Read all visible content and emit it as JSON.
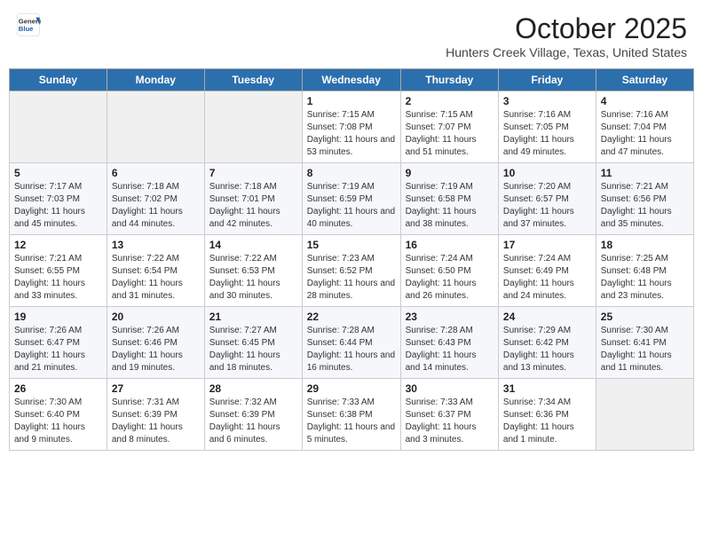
{
  "header": {
    "logo_general": "General",
    "logo_blue": "Blue",
    "month_title": "October 2025",
    "location": "Hunters Creek Village, Texas, United States"
  },
  "days_of_week": [
    "Sunday",
    "Monday",
    "Tuesday",
    "Wednesday",
    "Thursday",
    "Friday",
    "Saturday"
  ],
  "weeks": [
    [
      {
        "day": "",
        "empty": true
      },
      {
        "day": "",
        "empty": true
      },
      {
        "day": "",
        "empty": true
      },
      {
        "day": "1",
        "sunrise": "7:15 AM",
        "sunset": "7:08 PM",
        "daylight": "11 hours and 53 minutes."
      },
      {
        "day": "2",
        "sunrise": "7:15 AM",
        "sunset": "7:07 PM",
        "daylight": "11 hours and 51 minutes."
      },
      {
        "day": "3",
        "sunrise": "7:16 AM",
        "sunset": "7:05 PM",
        "daylight": "11 hours and 49 minutes."
      },
      {
        "day": "4",
        "sunrise": "7:16 AM",
        "sunset": "7:04 PM",
        "daylight": "11 hours and 47 minutes."
      }
    ],
    [
      {
        "day": "5",
        "sunrise": "7:17 AM",
        "sunset": "7:03 PM",
        "daylight": "11 hours and 45 minutes."
      },
      {
        "day": "6",
        "sunrise": "7:18 AM",
        "sunset": "7:02 PM",
        "daylight": "11 hours and 44 minutes."
      },
      {
        "day": "7",
        "sunrise": "7:18 AM",
        "sunset": "7:01 PM",
        "daylight": "11 hours and 42 minutes."
      },
      {
        "day": "8",
        "sunrise": "7:19 AM",
        "sunset": "6:59 PM",
        "daylight": "11 hours and 40 minutes."
      },
      {
        "day": "9",
        "sunrise": "7:19 AM",
        "sunset": "6:58 PM",
        "daylight": "11 hours and 38 minutes."
      },
      {
        "day": "10",
        "sunrise": "7:20 AM",
        "sunset": "6:57 PM",
        "daylight": "11 hours and 37 minutes."
      },
      {
        "day": "11",
        "sunrise": "7:21 AM",
        "sunset": "6:56 PM",
        "daylight": "11 hours and 35 minutes."
      }
    ],
    [
      {
        "day": "12",
        "sunrise": "7:21 AM",
        "sunset": "6:55 PM",
        "daylight": "11 hours and 33 minutes."
      },
      {
        "day": "13",
        "sunrise": "7:22 AM",
        "sunset": "6:54 PM",
        "daylight": "11 hours and 31 minutes."
      },
      {
        "day": "14",
        "sunrise": "7:22 AM",
        "sunset": "6:53 PM",
        "daylight": "11 hours and 30 minutes."
      },
      {
        "day": "15",
        "sunrise": "7:23 AM",
        "sunset": "6:52 PM",
        "daylight": "11 hours and 28 minutes."
      },
      {
        "day": "16",
        "sunrise": "7:24 AM",
        "sunset": "6:50 PM",
        "daylight": "11 hours and 26 minutes."
      },
      {
        "day": "17",
        "sunrise": "7:24 AM",
        "sunset": "6:49 PM",
        "daylight": "11 hours and 24 minutes."
      },
      {
        "day": "18",
        "sunrise": "7:25 AM",
        "sunset": "6:48 PM",
        "daylight": "11 hours and 23 minutes."
      }
    ],
    [
      {
        "day": "19",
        "sunrise": "7:26 AM",
        "sunset": "6:47 PM",
        "daylight": "11 hours and 21 minutes."
      },
      {
        "day": "20",
        "sunrise": "7:26 AM",
        "sunset": "6:46 PM",
        "daylight": "11 hours and 19 minutes."
      },
      {
        "day": "21",
        "sunrise": "7:27 AM",
        "sunset": "6:45 PM",
        "daylight": "11 hours and 18 minutes."
      },
      {
        "day": "22",
        "sunrise": "7:28 AM",
        "sunset": "6:44 PM",
        "daylight": "11 hours and 16 minutes."
      },
      {
        "day": "23",
        "sunrise": "7:28 AM",
        "sunset": "6:43 PM",
        "daylight": "11 hours and 14 minutes."
      },
      {
        "day": "24",
        "sunrise": "7:29 AM",
        "sunset": "6:42 PM",
        "daylight": "11 hours and 13 minutes."
      },
      {
        "day": "25",
        "sunrise": "7:30 AM",
        "sunset": "6:41 PM",
        "daylight": "11 hours and 11 minutes."
      }
    ],
    [
      {
        "day": "26",
        "sunrise": "7:30 AM",
        "sunset": "6:40 PM",
        "daylight": "11 hours and 9 minutes."
      },
      {
        "day": "27",
        "sunrise": "7:31 AM",
        "sunset": "6:39 PM",
        "daylight": "11 hours and 8 minutes."
      },
      {
        "day": "28",
        "sunrise": "7:32 AM",
        "sunset": "6:39 PM",
        "daylight": "11 hours and 6 minutes."
      },
      {
        "day": "29",
        "sunrise": "7:33 AM",
        "sunset": "6:38 PM",
        "daylight": "11 hours and 5 minutes."
      },
      {
        "day": "30",
        "sunrise": "7:33 AM",
        "sunset": "6:37 PM",
        "daylight": "11 hours and 3 minutes."
      },
      {
        "day": "31",
        "sunrise": "7:34 AM",
        "sunset": "6:36 PM",
        "daylight": "11 hours and 1 minute."
      },
      {
        "day": "",
        "empty": true
      }
    ]
  ]
}
